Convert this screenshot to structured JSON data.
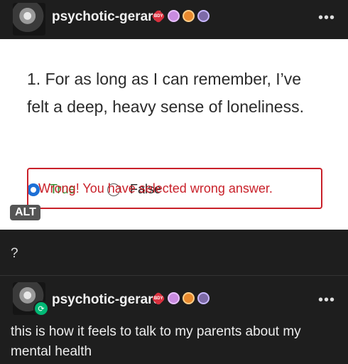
{
  "post": {
    "username": "psychotic-gerard",
    "badges": [
      "BDY",
      "",
      "",
      ""
    ],
    "more": "•••",
    "image": {
      "question": "1. For as long as I can remember, I’ve felt a deep, heavy sense of loneliness.",
      "option_true": "True",
      "option_false": "False",
      "feedback": "Wrong! You have selected wrong answer.",
      "alt_badge": "ALT"
    },
    "caption": "?"
  },
  "reblog": {
    "username": "psychotic-gerard",
    "badges": [
      "BDY",
      "",
      "",
      ""
    ],
    "more": "•••",
    "text": "this is how it feels to talk to my parents about my mental health"
  },
  "colors": {
    "background": "#1e1e1e",
    "wrong_red": "#c9212a",
    "true_green": "#2d8a2b",
    "radio_blue": "#1d70d6",
    "reblog_green": "#01b875"
  }
}
